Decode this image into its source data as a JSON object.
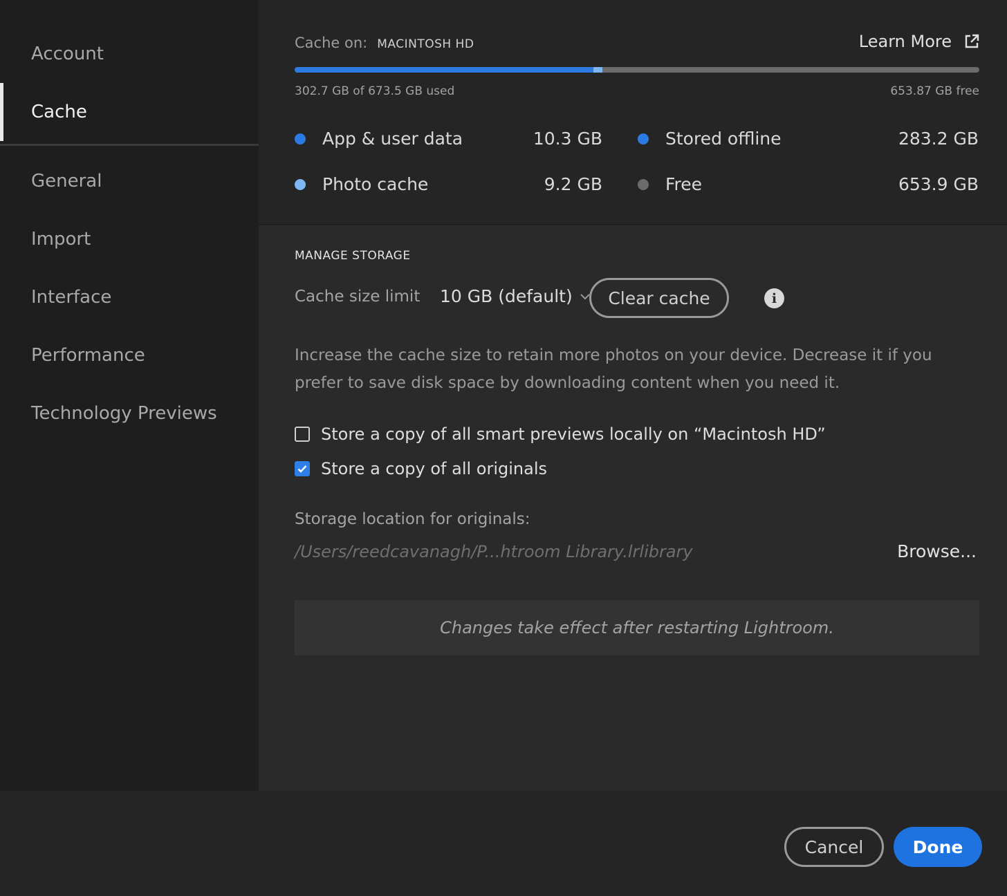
{
  "sidebar": {
    "items": [
      {
        "label": "Account"
      },
      {
        "label": "Cache",
        "active": true
      },
      {
        "label": "General"
      },
      {
        "label": "Import"
      },
      {
        "label": "Interface"
      },
      {
        "label": "Performance"
      },
      {
        "label": "Technology Previews"
      }
    ]
  },
  "storage": {
    "cache_on_label": "Cache on:",
    "drive_name": "MACINTOSH HD",
    "learn_more": "Learn More",
    "used_text": "302.7 GB of 673.5 GB used",
    "free_text": "653.87 GB free",
    "usage_fraction": 0.449,
    "usage_dark_fraction": 0.436,
    "legend": [
      {
        "label": "App & user data",
        "value": "10.3 GB",
        "color": "#2d7be0"
      },
      {
        "label": "Stored offline",
        "value": "283.2 GB",
        "color": "#2d7be0"
      },
      {
        "label": "Photo cache",
        "value": "9.2 GB",
        "color": "#7db6f2"
      },
      {
        "label": "Free",
        "value": "653.9 GB",
        "color": "#6b6b6b"
      }
    ]
  },
  "manage": {
    "title": "MANAGE STORAGE",
    "cache_limit_label": "Cache size limit",
    "cache_limit_value": "10 GB (default)",
    "clear_cache": "Clear cache",
    "description": "Increase the cache size to retain more photos on your device. Decrease it if you prefer to save disk space by downloading content when you need it.",
    "smart_previews_label": "Store a copy of all smart previews locally on “Macintosh HD”",
    "smart_previews_checked": false,
    "originals_label": "Store a copy of all originals",
    "originals_checked": true,
    "location_label": "Storage location for originals:",
    "location_path": "/Users/reedcavanagh/P...htroom Library.lrlibrary",
    "browse": "Browse...",
    "notice": "Changes take effect after restarting Lightroom."
  },
  "footer": {
    "cancel": "Cancel",
    "done": "Done"
  },
  "colors": {
    "accent": "#1f73e0",
    "background": "#232323"
  }
}
